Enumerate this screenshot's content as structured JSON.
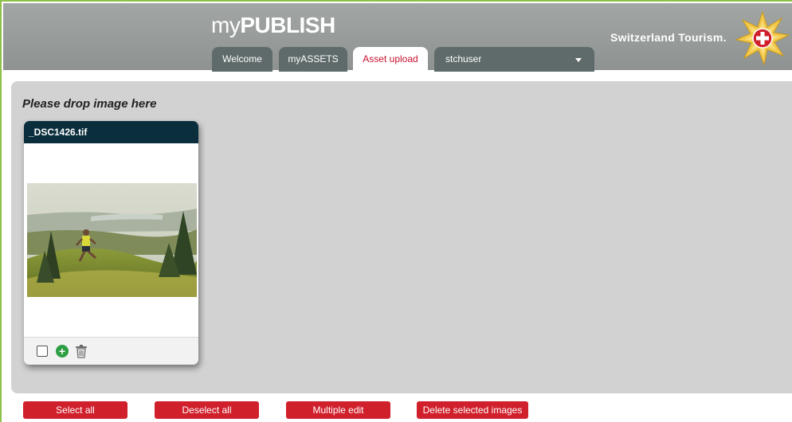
{
  "header": {
    "title_prefix": "my",
    "title_main": "PUBLISH",
    "brand_name": "Switzerland Tourism.",
    "tabs": [
      {
        "label": "Welcome",
        "active": false
      },
      {
        "label": "myASSETS",
        "active": false
      },
      {
        "label": "Asset upload",
        "active": true
      }
    ],
    "user_select": {
      "value": "stchuser"
    }
  },
  "drop_zone": {
    "title": "Please drop image here"
  },
  "asset_card": {
    "filename": "_DSC1426.tif",
    "icons": [
      "checkbox-icon",
      "add-icon",
      "trash-icon"
    ],
    "add_glyph": "+"
  },
  "actions": {
    "select_all": "Select all",
    "deselect_all": "Deselect all",
    "multiple_edit": "Multiple edit",
    "delete_selected": "Delete selected images"
  },
  "colors": {
    "accent_red": "#d0202c",
    "active_tab_text": "#c8102e",
    "header_gray": "#9a9e9d",
    "tab_dark": "#5f6b6b",
    "card_header": "#0b2e3c",
    "frame_green": "#8fc04a",
    "add_green": "#2e9e44"
  }
}
